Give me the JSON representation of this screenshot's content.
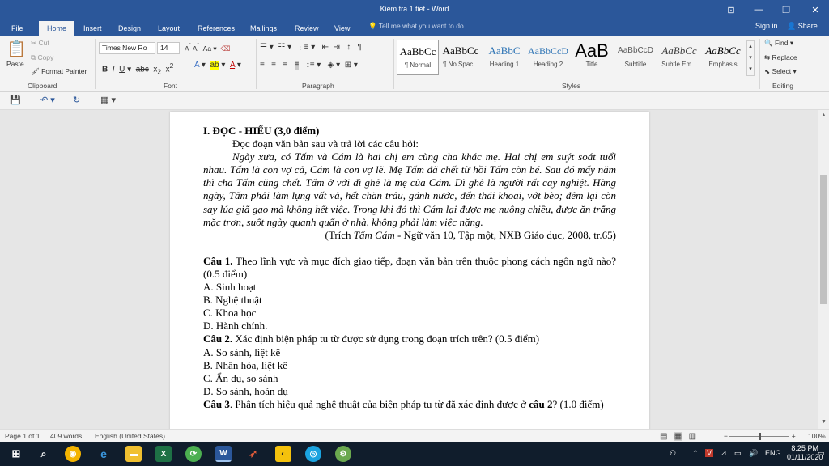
{
  "window": {
    "title": "Kiem tra 1 tiet - Word",
    "controls": [
      "⊡",
      "—",
      "❐",
      "✕"
    ]
  },
  "tabs": [
    "File",
    "Home",
    "Insert",
    "Design",
    "Layout",
    "References",
    "Mailings",
    "Review",
    "View"
  ],
  "tell_me": "Tell me what you want to do...",
  "account": {
    "signin": "Sign in",
    "share": "Share"
  },
  "clipboard": {
    "paste": "Paste",
    "cut": "Cut",
    "copy": "Copy",
    "format_painter": "Format Painter",
    "label": "Clipboard"
  },
  "font": {
    "name": "Times New Ro",
    "size": "14",
    "label": "Font"
  },
  "paragraph": {
    "label": "Paragraph"
  },
  "styles": {
    "label": "Styles",
    "items": [
      {
        "preview": "AaBbCc",
        "name": "¶ Normal",
        "color": "#000000"
      },
      {
        "preview": "AaBbCc",
        "name": "¶ No Spac...",
        "color": "#000000"
      },
      {
        "preview": "AaBbC",
        "name": "Heading 1",
        "color": "#2e74b5"
      },
      {
        "preview": "AaBbCcD",
        "name": "Heading 2",
        "color": "#2e74b5"
      },
      {
        "preview": "AaB",
        "name": "Title",
        "color": "#000000"
      },
      {
        "preview": "AaBbCcD",
        "name": "Subtitle",
        "color": "#595959"
      },
      {
        "preview": "AaBbCc",
        "name": "Subtle Em...",
        "color": "#404040"
      },
      {
        "preview": "AaBbCc",
        "name": "Emphasis",
        "color": "#000000"
      }
    ]
  },
  "editing": {
    "find": "Find",
    "replace": "Replace",
    "select": "Select",
    "label": "Editing"
  },
  "document": {
    "heading": "I. ĐỌC - HIỂU (3,0 điểm)",
    "instruction": "Đọc đoạn văn bản sau và trả lời các câu hỏi:",
    "passage": "Ngày xưa, có Tấm và Cám là hai chị em cùng cha khác mẹ. Hai chị em suýt soát tuổi nhau. Tấm là con vợ cả, Cám là con vợ lẽ. Mẹ Tấm đã chết từ hồi Tấm còn bé. Sau đó mấy năm thì cha Tấm cũng chết. Tấm ở với dì ghẻ là mẹ của Cám. Dì ghẻ là người rất cay nghiệt. Hàng ngày, Tấm phải làm lụng vất vả, hết chăn trâu, gánh nước, đến thái khoai, vớt bèo; đêm lại còn say lúa giã gạo mà không hết việc. Trong khi đó thì Cám lại được mẹ nuông chiều, được ăn trắng mặc trơn, suốt ngày quanh quẩn ở nhà, không phải làm việc nặng.",
    "citation_pre": "(Trích ",
    "citation_title": "Tấm Cám",
    "citation_post": " - Ngữ văn 10, Tập một, NXB Giáo dục, 2008, tr.65)",
    "q1_label": "Câu 1.",
    "q1_text": " Theo lĩnh vực và mục đích giao tiếp, đoạn văn bản trên thuộc phong cách ngôn ngữ nào? (0.5 điểm)",
    "q1_options": [
      "A. Sinh hoạt",
      "B. Nghệ thuật",
      "C. Khoa học",
      "D. Hành chính."
    ],
    "q2_label": "Câu 2.",
    "q2_text": " Xác định biện pháp tu từ được sử dụng trong đoạn trích trên? (0.5 điểm)",
    "q2_options": [
      "A. So sánh, liệt kê",
      "B. Nhân hóa, liệt kê",
      "C. Ẩn dụ, so sánh",
      "D. So sánh, hoán dụ"
    ],
    "q3_label": "Câu 3",
    "q3_text": ". Phân tích hiệu quả nghệ thuật của biện pháp tu từ đã xác định được ở ",
    "q3_ref": "câu 2",
    "q3_end": "? (1.0 điểm)"
  },
  "status": {
    "page": "Page 1 of 1",
    "words": "409 words",
    "language": "English (United States)",
    "zoom": "100%"
  },
  "tray": {
    "lang": "ENG",
    "time": "8:25 PM",
    "date": "01/11/2020"
  }
}
